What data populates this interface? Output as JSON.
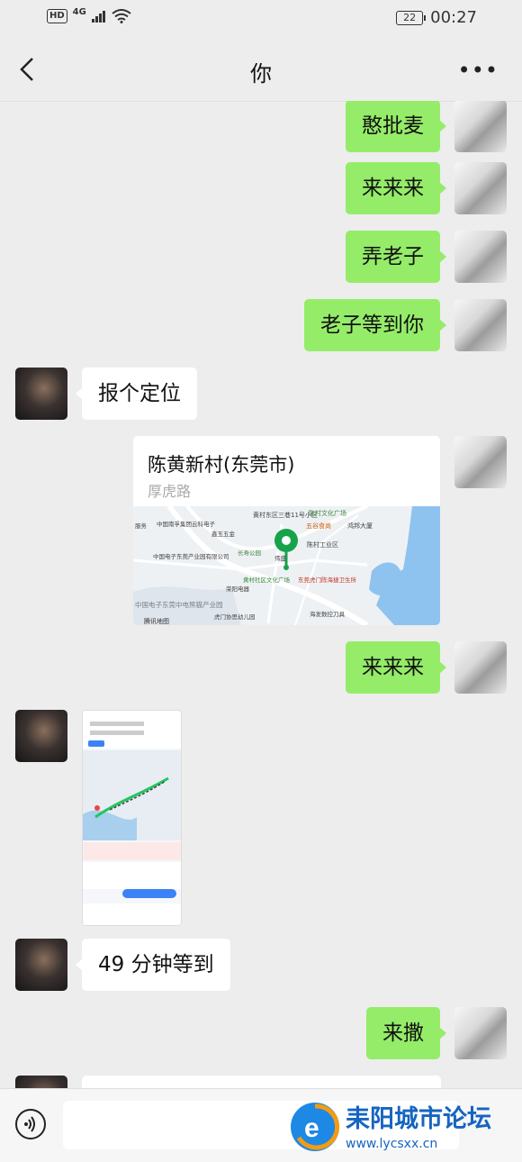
{
  "status_bar": {
    "hd": "HD",
    "network": "4G",
    "battery": "22",
    "time": "00:27"
  },
  "header": {
    "title": "你"
  },
  "messages": [
    {
      "from": "me",
      "text": "憨批麦"
    },
    {
      "from": "me",
      "text": "来来来"
    },
    {
      "from": "me",
      "text": "弄老子"
    },
    {
      "from": "me",
      "text": "老子等到你"
    },
    {
      "from": "other",
      "text": "报个定位"
    },
    {
      "from": "me",
      "type": "location",
      "title": "陈黄新村(东莞市)",
      "subtitle": "厚虎路",
      "map_labels": [
        "黄村东区三巷11号小区",
        "陈村文化广场",
        "五谷食尚",
        "鸿邦大厦",
        "陈村工业区",
        "中国南孚集团云科电子",
        "鑫玉五金",
        "长寿公园",
        "中国电子东莞产业园有限公司",
        "伟盛",
        "黄村社区文化广场",
        "东莞虎门陈海捷卫生所",
        "荣阳电器",
        "中国电子东莞中电熊猫产业园",
        "虎门协思幼儿园",
        "海发数控刀具",
        "腾讯地图",
        "服务"
      ]
    },
    {
      "from": "me",
      "text": "来来来"
    },
    {
      "from": "other",
      "type": "image"
    },
    {
      "from": "other",
      "text": "49 分钟等到"
    },
    {
      "from": "me",
      "text": "来撒"
    }
  ],
  "watermark": {
    "name": "耒阳城市论坛",
    "url": "www.lycsxx.cn"
  }
}
